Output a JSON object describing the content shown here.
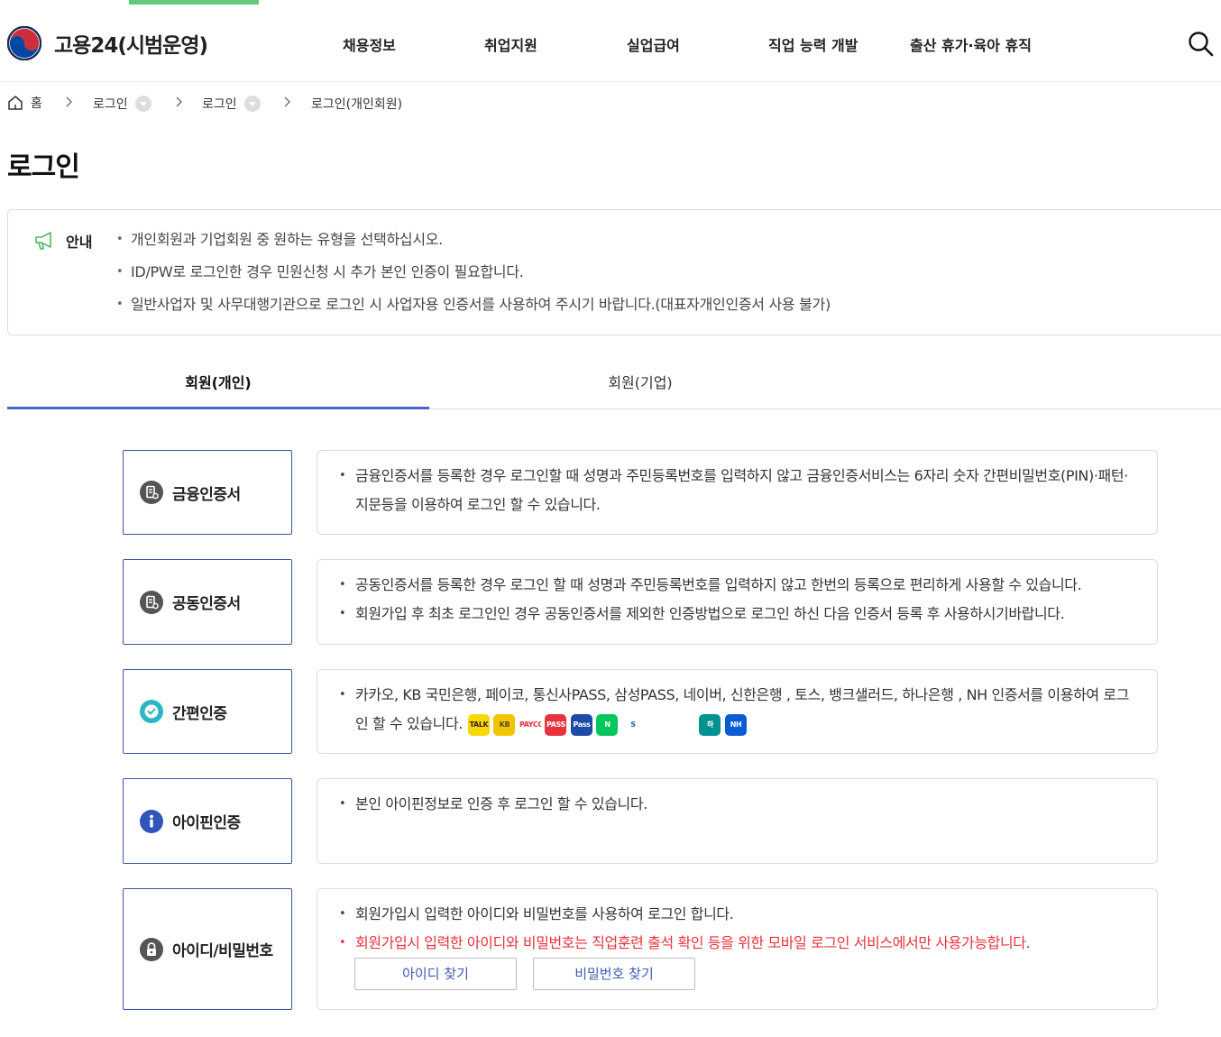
{
  "progress": {
    "percent": 10.6,
    "color": "#63c97a"
  },
  "header": {
    "logo_text": "고용24(시범운영)",
    "nav": [
      "채용정보",
      "취업지원",
      "실업급여",
      "직업 능력 개발",
      "출산 휴가·육아 휴직"
    ]
  },
  "breadcrumb": {
    "home": "홈",
    "items": [
      "로그인",
      "로그인",
      "로그인(개인회원)"
    ]
  },
  "page_title": "로그인",
  "notice": {
    "label": "안내",
    "items": [
      "개인회원과 기업회원 중 원하는 유형을 선택하십시오.",
      "ID/PW로 로그인한 경우 민원신청 시 추가 본인 인증이 필요합니다.",
      "일반사업자 및 사무대행기관으로 로그인 시 사업자용 인증서를 사용하여 주시기 바랍니다.(대표자개인인증서 사용 불가)"
    ]
  },
  "tabs": [
    {
      "label": "회원(개인)",
      "active": true
    },
    {
      "label": "회원(기업)",
      "active": false
    }
  ],
  "methods": [
    {
      "label": "금융인증서",
      "icon": "certificate-icon",
      "desc": [
        "금융인증서를 등록한 경우 로그인할 때 성명과 주민등록번호를 입력하지 않고 금융인증서비스는 6자리 숫자 간편비밀번호(PIN)·패턴·지문등을 이용하여 로그인 할 수 있습니다."
      ]
    },
    {
      "label": "공동인증서",
      "icon": "certificate-icon",
      "desc": [
        "공동인증서를 등록한 경우 로그인 할 때 성명과 주민등록번호를 입력하지 않고 한번의 등록으로 편리하게 사용할 수 있습니다.",
        "회원가입 후 최초 로그인인 경우 공동인증서를 제외한 인증방법으로 로그인 하신 다음 인증서 등록 후 사용하시기바랍니다."
      ]
    },
    {
      "label": "간편인증",
      "icon": "check-shield-icon",
      "desc": [
        "카카오, KB 국민은행, 페이코, 통신사PASS, 삼성PASS, 네이버, 신한은행 , 토스, 뱅크샐러드, 하나은행 , NH 인증서를 이용하여 로그인 할 수 있습니다."
      ]
    },
    {
      "label": "아이핀인증",
      "icon": "info-icon",
      "desc": [
        "본인 아이핀정보로 인증 후 로그인 할 수 있습니다."
      ]
    },
    {
      "label": "아이디/비밀번호",
      "icon": "lock-icon",
      "desc": [
        "회원가입시 입력한 아이디와 비밀번호를 사용하여 로그인 합니다."
      ],
      "warning": "회원가입시 입력한 아이디와 비밀번호는 직업훈련 출석 확인 등을 위한 모바일 로그인 서비스에서만 사용가능합니다.",
      "find_id": "아이디 찾기",
      "find_pw": "비밀번호 찾기"
    }
  ],
  "brands": [
    {
      "name": "kakao-icon",
      "text": "TALK",
      "bg": "#f7d800",
      "fg": "#3b1e1e"
    },
    {
      "name": "kb-icon",
      "text": "KB",
      "bg": "#f2c500",
      "fg": "#5a4a2a"
    },
    {
      "name": "payco-icon",
      "text": "PAYCO",
      "bg": "#ffffff",
      "fg": "#e8323c"
    },
    {
      "name": "pass-icon",
      "text": "PASS",
      "bg": "#e8323c",
      "fg": "#ffffff"
    },
    {
      "name": "samsung-pass-icon",
      "text": "Pass",
      "bg": "#1f4aa8",
      "fg": "#ffffff"
    },
    {
      "name": "naver-icon",
      "text": "N",
      "bg": "#03c75a",
      "fg": "#ffffff"
    },
    {
      "name": "shinhan-icon",
      "text": "S",
      "bg": "#ffffff",
      "fg": "#1f5bbf"
    },
    {
      "name": "toss-icon",
      "text": "",
      "bg": "#ffffff",
      "fg": "#1b64da"
    },
    {
      "name": "banksalad-icon",
      "text": "",
      "bg": "#ffffff",
      "fg": "#14c38e"
    },
    {
      "name": "hana-icon",
      "text": "하",
      "bg": "#00928f",
      "fg": "#ffffff"
    },
    {
      "name": "nh-icon",
      "text": "NH",
      "bg": "#0b5bd3",
      "fg": "#ffffff"
    }
  ],
  "colors": {
    "accent": "#4a63d1",
    "method_border": "#3e54a3",
    "warning": "#e8323c",
    "link": "#3e5bb5",
    "brand_green": "#63c97a"
  }
}
